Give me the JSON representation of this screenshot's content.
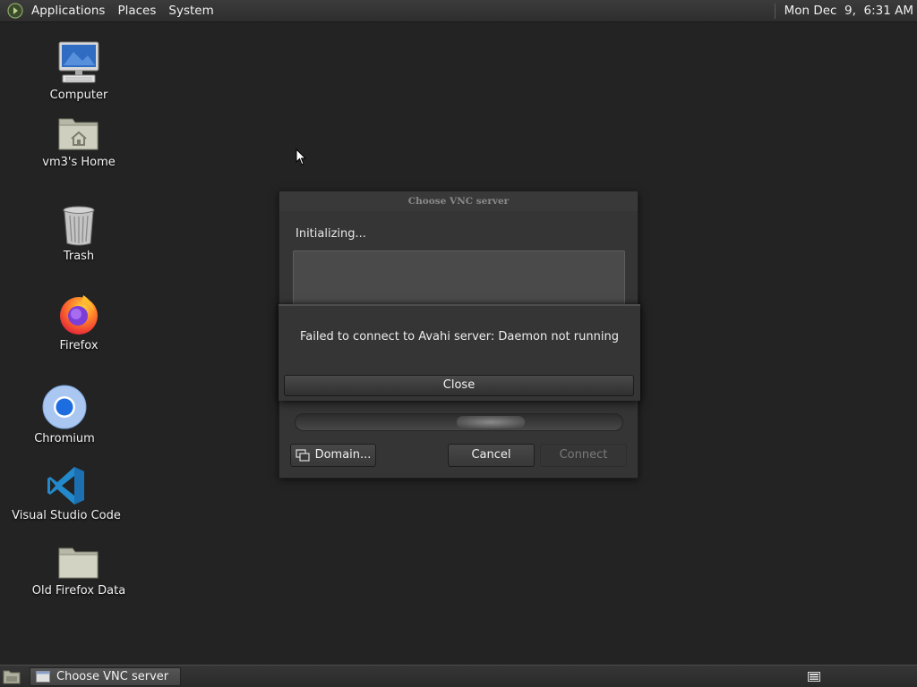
{
  "top_panel": {
    "menus": [
      "Applications",
      "Places",
      "System"
    ],
    "clock": "Mon Dec  9,  6:31 AM"
  },
  "desktop": {
    "icons": [
      {
        "label": "Computer",
        "icon": "computer-icon"
      },
      {
        "label": "vm3's Home",
        "icon": "home-folder-icon"
      },
      {
        "label": "Trash",
        "icon": "trash-icon"
      },
      {
        "label": "Firefox",
        "icon": "firefox-icon"
      },
      {
        "label": "Chromium",
        "icon": "chromium-icon"
      },
      {
        "label": "Visual Studio Code",
        "icon": "vscode-icon"
      },
      {
        "label": "Old Firefox Data",
        "icon": "folder-icon"
      }
    ]
  },
  "vnc_dialog": {
    "title": "Choose VNC server",
    "status": "Initializing...",
    "domain_button": "Domain...",
    "cancel_button": "Cancel",
    "connect_button": "Connect"
  },
  "error_dialog": {
    "message": "Failed to connect to Avahi server: Daemon not running",
    "close_button": "Close"
  },
  "taskbar": {
    "tasks": [
      {
        "label": "Choose VNC server"
      }
    ]
  },
  "colors": {
    "desktop_bg": "#232323",
    "panel_bg": "#333333",
    "dialog_bg": "#353535"
  }
}
